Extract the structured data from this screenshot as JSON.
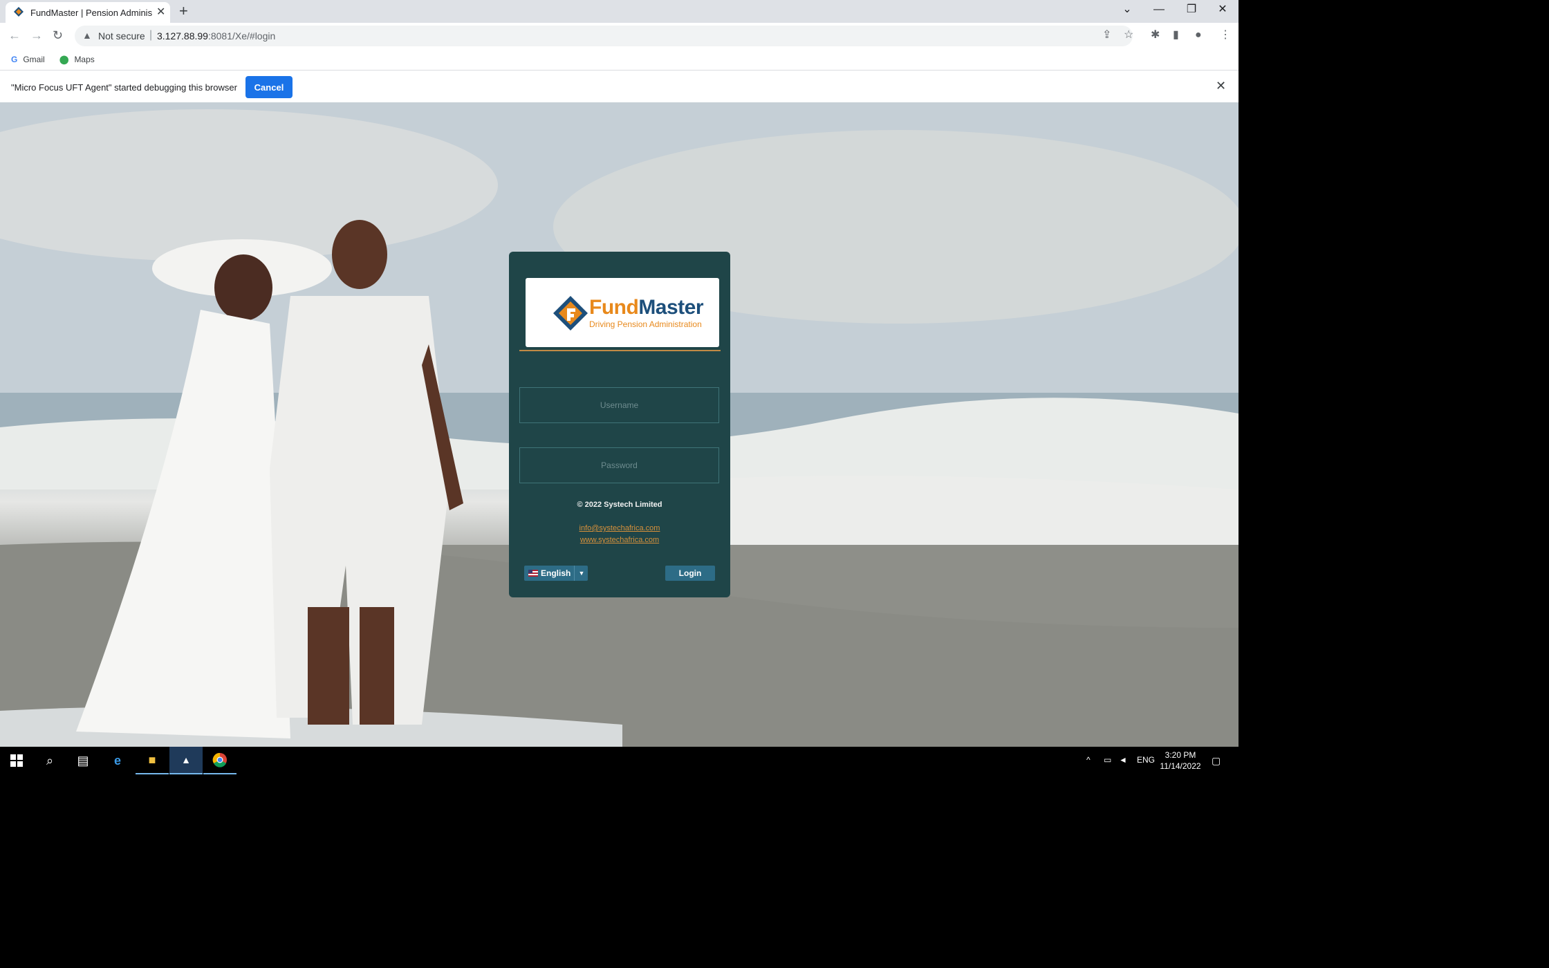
{
  "browser": {
    "tab_title": "FundMaster | Pension Administra",
    "security_label": "Not secure",
    "url_host": "3.127.88.99",
    "url_rest": ":8081/Xe/#login",
    "bookmarks": [
      {
        "label": "Gmail"
      },
      {
        "label": "Maps"
      }
    ],
    "infobar": {
      "message": "\"Micro Focus UFT Agent\" started debugging this browser",
      "cancel_label": "Cancel"
    }
  },
  "login": {
    "logo": {
      "word1": "Fund",
      "word2": "Master",
      "tagline": "Driving Pension Administration"
    },
    "username_placeholder": "Username",
    "password_placeholder": "Password",
    "copyright": "© 2022 Systech Limited",
    "email_link": "info@systechafrica.com",
    "website_link": "www.systechafrica.com",
    "language": "English",
    "login_label": "Login"
  },
  "taskbar": {
    "language": "ENG",
    "time": "3:20 PM",
    "date": "11/14/2022"
  },
  "colors": {
    "card_bg": "#1f4548",
    "accent_orange": "#e8891c",
    "brand_blue": "#1d4f7b",
    "button_blue": "#2d6c86",
    "infobar_button": "#1a73e8"
  }
}
